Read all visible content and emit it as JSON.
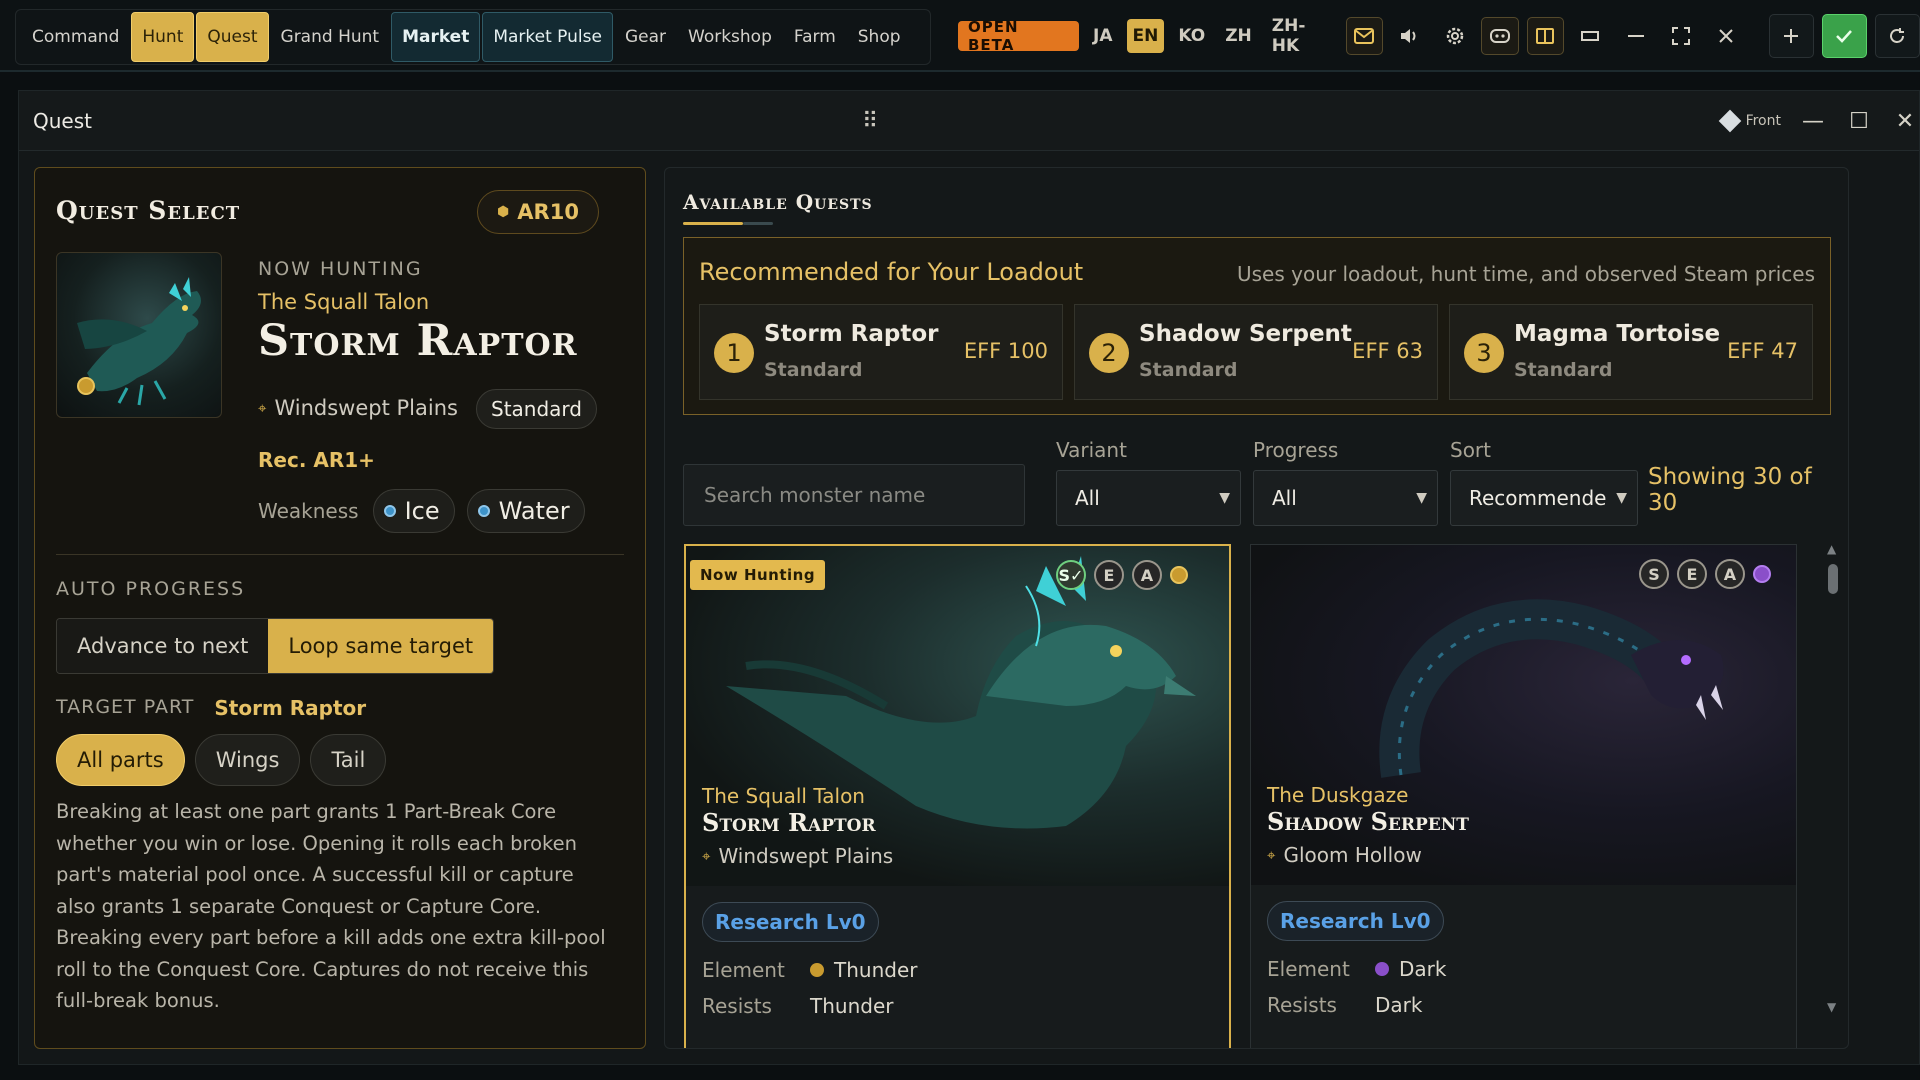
{
  "nav": {
    "items": [
      {
        "label": "Command",
        "style": "plain"
      },
      {
        "label": "Hunt",
        "style": "gold"
      },
      {
        "label": "Quest",
        "style": "gold"
      },
      {
        "label": "Grand Hunt",
        "style": "plain"
      },
      {
        "label": "Market",
        "style": "teal-bold"
      },
      {
        "label": "Market Pulse",
        "style": "teal"
      },
      {
        "label": "Gear",
        "style": "plain"
      },
      {
        "label": "Workshop",
        "style": "plain"
      },
      {
        "label": "Farm",
        "style": "plain"
      },
      {
        "label": "Shop",
        "style": "plain"
      }
    ]
  },
  "toolbar": {
    "beta_label": "OPEN BETA",
    "languages": [
      "JA",
      "EN",
      "KO",
      "ZH",
      "ZH-HK"
    ],
    "active_language": "EN",
    "icons": [
      "mail-icon",
      "speaker-icon",
      "gear-icon",
      "discord-icon",
      "book-icon",
      "restore-icon",
      "minimize-icon",
      "fullscreen-icon",
      "close-icon",
      "plus-icon",
      "check-icon",
      "refresh-icon"
    ]
  },
  "window": {
    "title": "Quest",
    "drag_glyph": "⠿",
    "front_label": "Front"
  },
  "quest_select": {
    "heading": "Quest Select",
    "ar_label": "AR10",
    "now_hunting_label": "NOW HUNTING",
    "monster_title": "The Squall Talon",
    "monster_name": "Storm Raptor",
    "location": "Windswept Plains",
    "rank": "Standard",
    "recommended": "Rec. AR1+",
    "weakness_label": "Weakness",
    "weaknesses": [
      "Ice",
      "Water"
    ],
    "auto_progress_label": "AUTO PROGRESS",
    "auto_progress_options": [
      "Advance to next",
      "Loop same target"
    ],
    "auto_progress_selected": "Loop same target",
    "target_part_label": "TARGET PART",
    "target_part_monster": "Storm Raptor",
    "parts": [
      "All parts",
      "Wings",
      "Tail"
    ],
    "part_selected": "All parts",
    "description": "Breaking at least one part grants 1 Part-Break Core whether you win or lose. Opening it rolls each broken part's material pool once. A successful kill or capture also grants 1 separate Conquest or Capture Core. Breaking every part before a kill adds one extra kill-pool roll to the Conquest Core. Captures do not receive this full-break bonus."
  },
  "available_quests": {
    "heading": "Available Quests",
    "recommended_title": "Recommended for Your Loadout",
    "recommended_note": "Uses your loadout, hunt time, and observed Steam prices",
    "recommendations": [
      {
        "rank": "1",
        "name": "Storm Raptor",
        "tier": "Standard",
        "eff": "EFF 100"
      },
      {
        "rank": "2",
        "name": "Shadow Serpent",
        "tier": "Standard",
        "eff": "EFF 63"
      },
      {
        "rank": "3",
        "name": "Magma Tortoise",
        "tier": "Standard",
        "eff": "EFF 47"
      }
    ],
    "search_placeholder": "Search monster name",
    "filters": {
      "variant_label": "Variant",
      "variant_value": "All",
      "progress_label": "Progress",
      "progress_value": "All",
      "sort_label": "Sort",
      "sort_value": "Recommende"
    },
    "showing": "Showing 30 of 30",
    "cards": [
      {
        "tag": "Now Hunting",
        "badges": [
          "S✓",
          "E",
          "A"
        ],
        "element_color": "#c99b2f",
        "title": "The Squall Talon",
        "name": "Storm Raptor",
        "location": "Windswept Plains",
        "research": "Research Lv0",
        "element_label": "Element",
        "element": "Thunder",
        "resists_label": "Resists",
        "resists": "Thunder"
      },
      {
        "tag": "",
        "badges": [
          "S",
          "E",
          "A"
        ],
        "element_color": "#8a4fc9",
        "title": "The Duskgaze",
        "name": "Shadow Serpent",
        "location": "Gloom Hollow",
        "research": "Research Lv0",
        "element_label": "Element",
        "element": "Dark",
        "resists_label": "Resists",
        "resists": "Dark"
      }
    ]
  },
  "colors": {
    "accent_gold": "#d9b14b",
    "beta_orange": "#e2761f",
    "teal_nav": "#132a32",
    "research_blue": "#5aa1e6",
    "confirm_green": "#3aa24a"
  }
}
